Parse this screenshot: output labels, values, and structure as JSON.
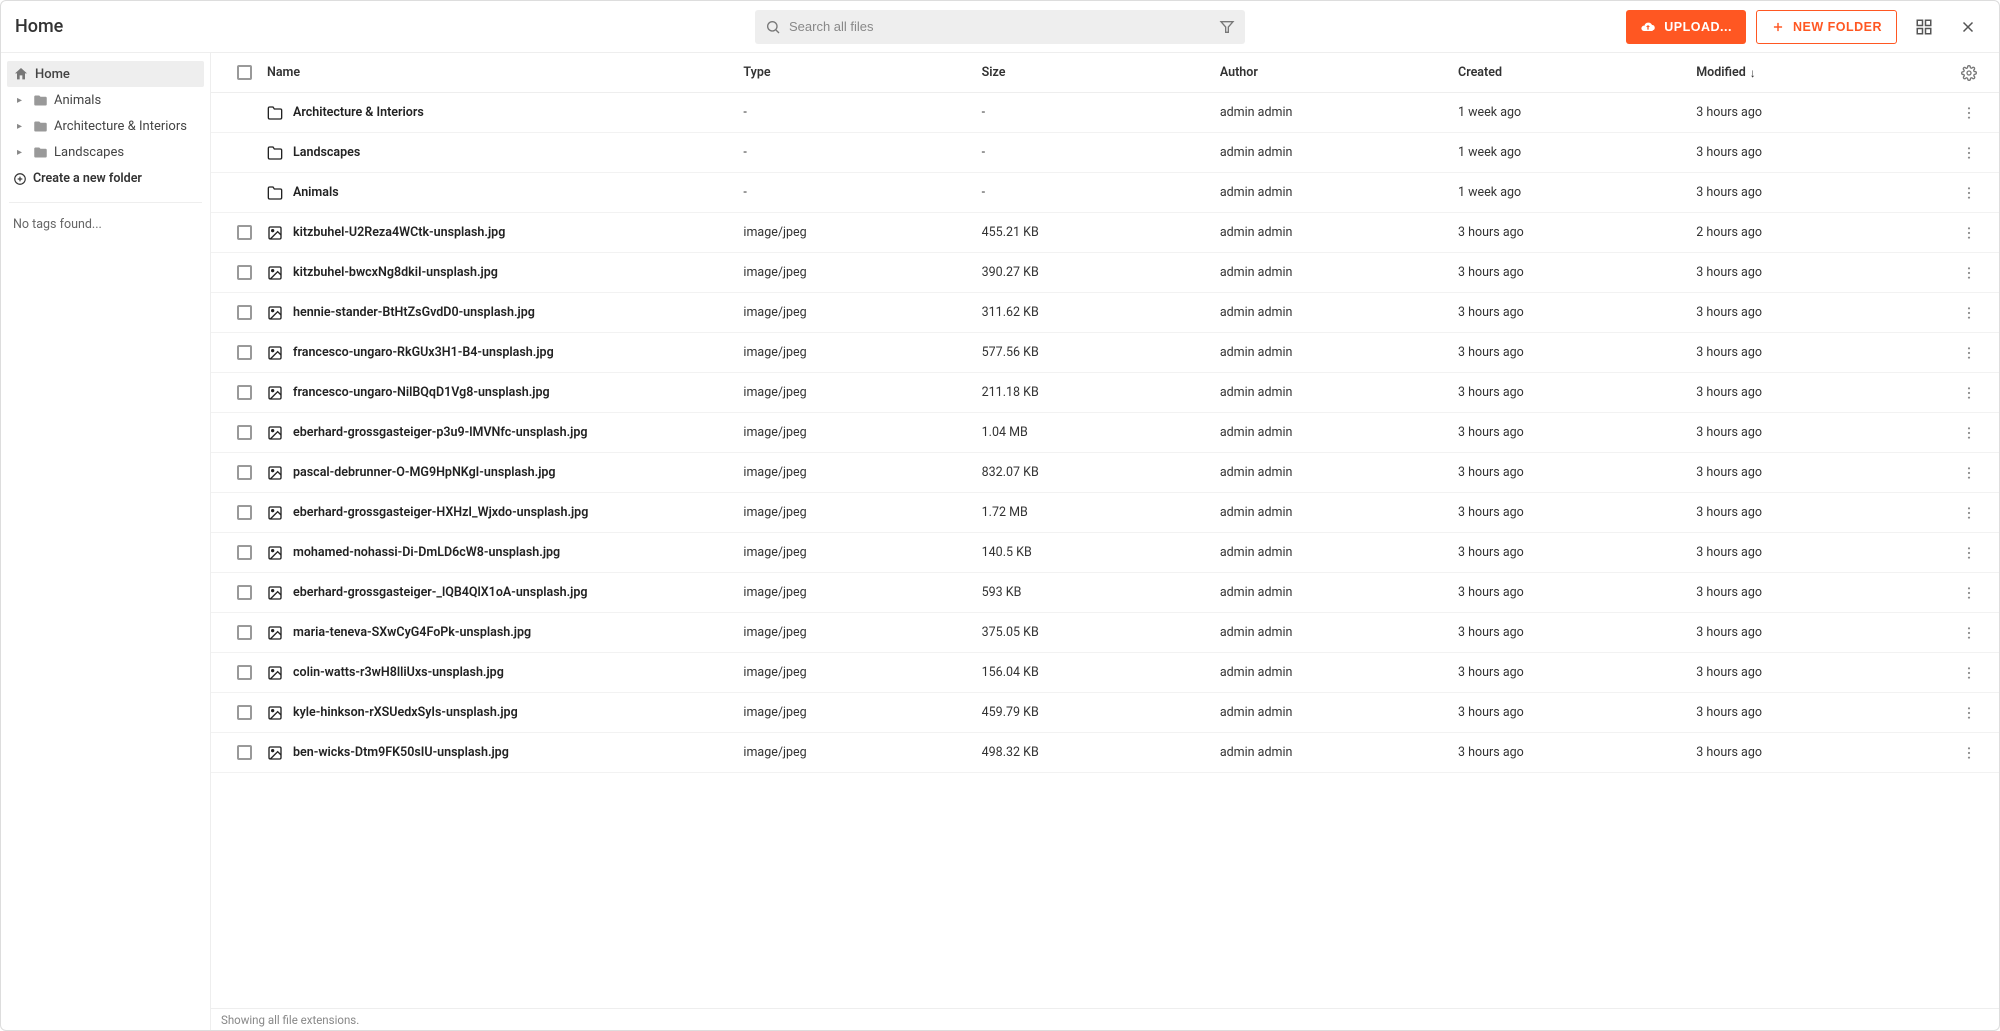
{
  "breadcrumb": "Home",
  "search": {
    "placeholder": "Search all files"
  },
  "buttons": {
    "upload": "UPLOAD...",
    "new_folder": "NEW FOLDER"
  },
  "sidebar": {
    "root": "Home",
    "folders": [
      {
        "label": "Animals"
      },
      {
        "label": "Architecture & Interiors"
      },
      {
        "label": "Landscapes"
      }
    ],
    "create_folder": "Create a new folder",
    "no_tags": "No tags found..."
  },
  "columns": {
    "name": "Name",
    "type": "Type",
    "size": "Size",
    "author": "Author",
    "created": "Created",
    "modified": "Modified"
  },
  "sort": {
    "column": "modified",
    "direction": "desc"
  },
  "rows": [
    {
      "kind": "folder",
      "name": "Architecture & Interiors",
      "type": "-",
      "size": "-",
      "author": "admin admin",
      "created": "1 week ago",
      "modified": "3 hours ago"
    },
    {
      "kind": "folder",
      "name": "Landscapes",
      "type": "-",
      "size": "-",
      "author": "admin admin",
      "created": "1 week ago",
      "modified": "3 hours ago"
    },
    {
      "kind": "folder",
      "name": "Animals",
      "type": "-",
      "size": "-",
      "author": "admin admin",
      "created": "1 week ago",
      "modified": "3 hours ago"
    },
    {
      "kind": "image",
      "name": "kitzbuhel-U2Reza4WCtk-unsplash.jpg",
      "type": "image/jpeg",
      "size": "455.21 KB",
      "author": "admin admin",
      "created": "3 hours ago",
      "modified": "2 hours ago"
    },
    {
      "kind": "image",
      "name": "kitzbuhel-bwcxNg8dkiI-unsplash.jpg",
      "type": "image/jpeg",
      "size": "390.27 KB",
      "author": "admin admin",
      "created": "3 hours ago",
      "modified": "3 hours ago"
    },
    {
      "kind": "image",
      "name": "hennie-stander-BtHtZsGvdD0-unsplash.jpg",
      "type": "image/jpeg",
      "size": "311.62 KB",
      "author": "admin admin",
      "created": "3 hours ago",
      "modified": "3 hours ago"
    },
    {
      "kind": "image",
      "name": "francesco-ungaro-RkGUx3H1-B4-unsplash.jpg",
      "type": "image/jpeg",
      "size": "577.56 KB",
      "author": "admin admin",
      "created": "3 hours ago",
      "modified": "3 hours ago"
    },
    {
      "kind": "image",
      "name": "francesco-ungaro-NilBQqD1Vg8-unsplash.jpg",
      "type": "image/jpeg",
      "size": "211.18 KB",
      "author": "admin admin",
      "created": "3 hours ago",
      "modified": "3 hours ago"
    },
    {
      "kind": "image",
      "name": "eberhard-grossgasteiger-p3u9-lMVNfc-unsplash.jpg",
      "type": "image/jpeg",
      "size": "1.04 MB",
      "author": "admin admin",
      "created": "3 hours ago",
      "modified": "3 hours ago"
    },
    {
      "kind": "image",
      "name": "pascal-debrunner-O-MG9HpNKgI-unsplash.jpg",
      "type": "image/jpeg",
      "size": "832.07 KB",
      "author": "admin admin",
      "created": "3 hours ago",
      "modified": "3 hours ago"
    },
    {
      "kind": "image",
      "name": "eberhard-grossgasteiger-HXHzI_Wjxdo-unsplash.jpg",
      "type": "image/jpeg",
      "size": "1.72 MB",
      "author": "admin admin",
      "created": "3 hours ago",
      "modified": "3 hours ago"
    },
    {
      "kind": "image",
      "name": "mohamed-nohassi-Di-DmLD6cW8-unsplash.jpg",
      "type": "image/jpeg",
      "size": "140.5 KB",
      "author": "admin admin",
      "created": "3 hours ago",
      "modified": "3 hours ago"
    },
    {
      "kind": "image",
      "name": "eberhard-grossgasteiger-_lQB4QlX1oA-unsplash.jpg",
      "type": "image/jpeg",
      "size": "593 KB",
      "author": "admin admin",
      "created": "3 hours ago",
      "modified": "3 hours ago"
    },
    {
      "kind": "image",
      "name": "maria-teneva-SXwCyG4FoPk-unsplash.jpg",
      "type": "image/jpeg",
      "size": "375.05 KB",
      "author": "admin admin",
      "created": "3 hours ago",
      "modified": "3 hours ago"
    },
    {
      "kind": "image",
      "name": "colin-watts-r3wH8lliUxs-unsplash.jpg",
      "type": "image/jpeg",
      "size": "156.04 KB",
      "author": "admin admin",
      "created": "3 hours ago",
      "modified": "3 hours ago"
    },
    {
      "kind": "image",
      "name": "kyle-hinkson-rXSUedxSyIs-unsplash.jpg",
      "type": "image/jpeg",
      "size": "459.79 KB",
      "author": "admin admin",
      "created": "3 hours ago",
      "modified": "3 hours ago"
    },
    {
      "kind": "image",
      "name": "ben-wicks-Dtm9FK50sIU-unsplash.jpg",
      "type": "image/jpeg",
      "size": "498.32 KB",
      "author": "admin admin",
      "created": "3 hours ago",
      "modified": "3 hours ago"
    }
  ],
  "footer": "Showing all file extensions."
}
